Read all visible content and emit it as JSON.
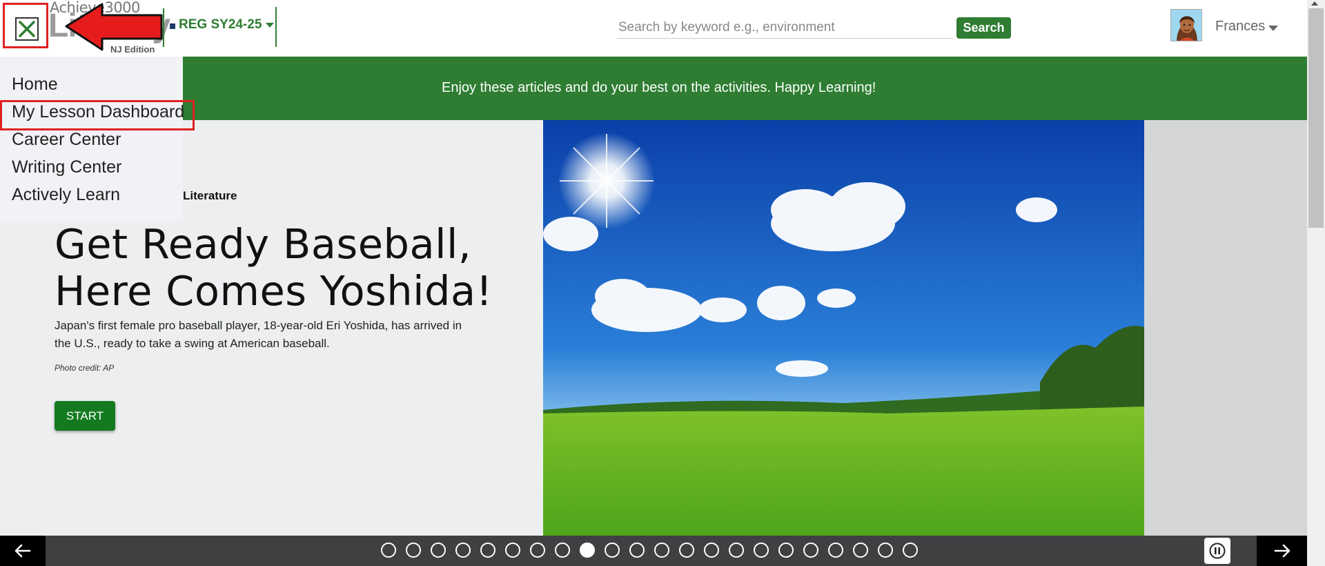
{
  "header": {
    "logo": {
      "brand": "Achieve3000",
      "product": "Literacy",
      "edition": "NJ Edition"
    },
    "class_selector": {
      "selected": "REG SY24-25"
    },
    "search": {
      "placeholder": "Search by keyword e.g., environment",
      "button_label": "Search"
    },
    "user": {
      "name": "Frances"
    }
  },
  "banner": {
    "message": "Enjoy these articles and do your best on the activities. Happy Learning!"
  },
  "menu": {
    "items": [
      {
        "label": "Home"
      },
      {
        "label": "My Lesson Dashboard"
      },
      {
        "label": "Career Center"
      },
      {
        "label": "Writing Center"
      },
      {
        "label": "Actively Learn"
      }
    ],
    "highlighted_index": 1
  },
  "hero": {
    "category": "Literature",
    "title_line1": "Get Ready Baseball,",
    "title_line2": "Here Comes Yoshida!",
    "description": "Japan's first female pro baseball player, 18-year-old Eri Yoshida, has arrived in the U.S., ready to take a swing at American baseball.",
    "photo_credit": "Photo credit: AP",
    "start_label": "START"
  },
  "carousel": {
    "slide_count": 22,
    "active_slide": 9
  },
  "icons": {
    "close": "close-icon",
    "prev": "arrow-left-icon",
    "next": "arrow-right-icon",
    "pause": "pause-icon",
    "annotation": "red-arrow-annotation"
  },
  "colors": {
    "brand_green": "#2e7d32",
    "start_green": "#137a1f",
    "annotation_red": "#e02020"
  }
}
